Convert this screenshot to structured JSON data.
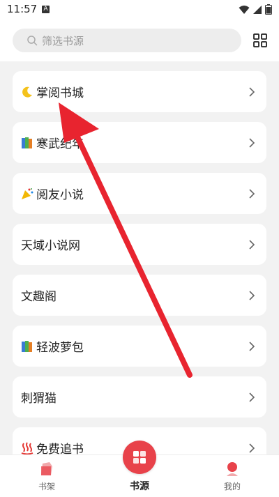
{
  "status_bar": {
    "time": "11:57",
    "notification_letter": "A"
  },
  "search": {
    "placeholder": "筛选书源"
  },
  "sources": [
    {
      "label": "掌阅书城",
      "icon": "crescent-moon-icon"
    },
    {
      "label": "寒武纪年",
      "icon": "books-icon"
    },
    {
      "label": "阅友小说",
      "icon": "party-popper-icon"
    },
    {
      "label": "天域小说网",
      "icon": ""
    },
    {
      "label": "文趣阁",
      "icon": ""
    },
    {
      "label": "轻波萝包",
      "icon": "books-icon"
    },
    {
      "label": "刺猬猫",
      "icon": ""
    },
    {
      "label": "免费追书",
      "icon": "hot-springs-icon"
    }
  ],
  "bottom_nav": {
    "bookshelf": "书架",
    "sources": "书源",
    "me": "我的"
  },
  "colors": {
    "accent": "#e8424a",
    "annotation_arrow": "#e8242f"
  }
}
